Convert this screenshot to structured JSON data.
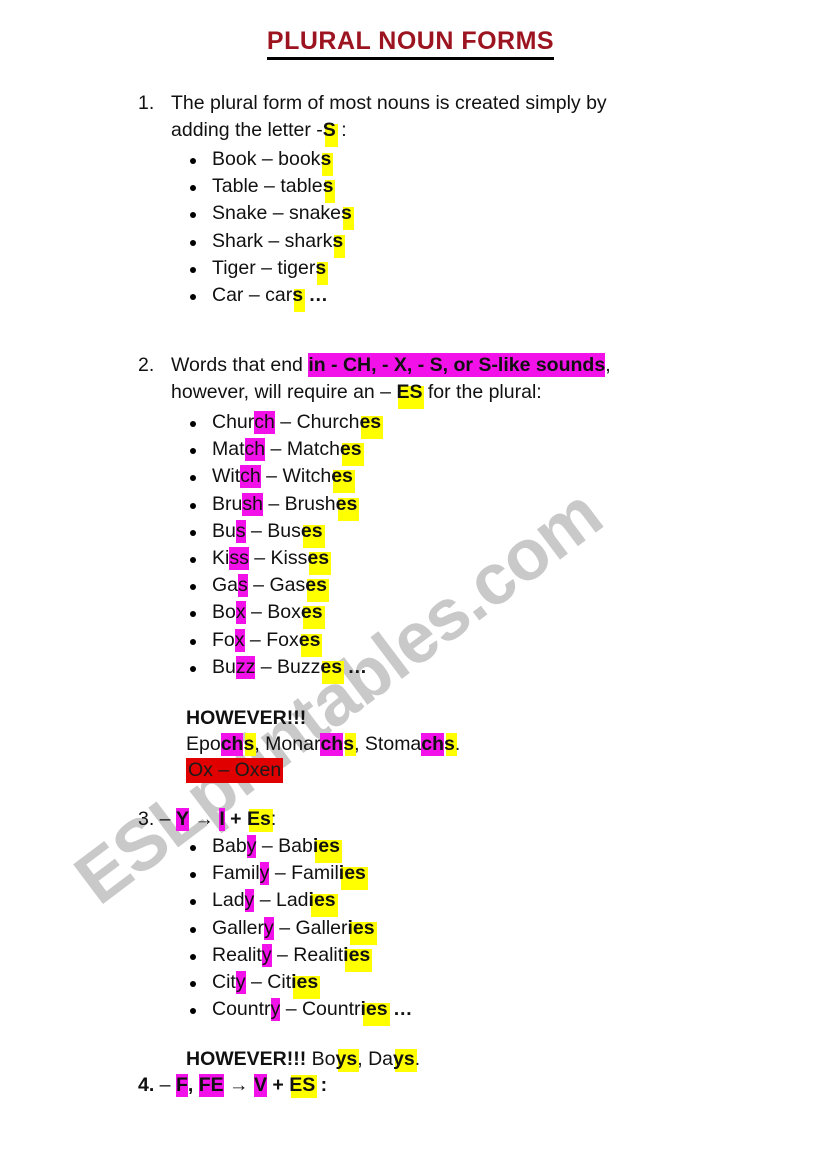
{
  "document": {
    "title": "PLURAL NOUN FORMS",
    "watermark": "ESLprintables.com",
    "colors": {
      "title": "#9c1420",
      "highlight_yellow": "#ffff00",
      "highlight_magenta": "#f211e8",
      "highlight_red": "#e00000",
      "watermark": "#c9c9c9",
      "text": "#111111"
    }
  },
  "sections": {
    "rule1": {
      "number": "1.",
      "line1": "The plural form of most nouns is created simply by",
      "line2_pre": "adding the letter -",
      "line2_highlight": "S",
      "line2_post": " :",
      "examples": [
        {
          "singular": "Book",
          "dash": " – ",
          "plural_stem": "book",
          "plural_suffix": "s",
          "trailing": ""
        },
        {
          "singular": "Table",
          "dash": " – ",
          "plural_stem": "table",
          "plural_suffix": "s",
          "trailing": ""
        },
        {
          "singular": "Snake",
          "dash": " – ",
          "plural_stem": "snake",
          "plural_suffix": "s",
          "trailing": ""
        },
        {
          "singular": "Shark",
          "dash": " – ",
          "plural_stem": "shark",
          "plural_suffix": "s",
          "trailing": ""
        },
        {
          "singular": "Tiger",
          "dash": " – ",
          "plural_stem": "tiger",
          "plural_suffix": "s",
          "trailing": ""
        },
        {
          "singular": "Car",
          "dash": " – ",
          "plural_stem": "car",
          "plural_suffix": "s",
          "trailing": " …"
        }
      ]
    },
    "rule2": {
      "number": "2.",
      "line1_pre": " Words that end ",
      "line1_highlight": "in  - CH, - X, - S, or S-like sounds",
      "line1_post": ",",
      "line2_pre": "however, will require an – ",
      "line2_highlight": "ES",
      "line2_post": " for the plural:",
      "examples": [
        {
          "sing_pre": "Chur",
          "sing_mark": "ch",
          "sing_post": "",
          "dash": " – ",
          "plu_pre": "Church",
          "plu_mark": "es",
          "plu_post": "",
          "trailing": ""
        },
        {
          "sing_pre": "Mat",
          "sing_mark": "ch",
          "sing_post": "",
          "dash": " – ",
          "plu_pre": "Match",
          "plu_mark": "es",
          "plu_post": "",
          "trailing": ""
        },
        {
          "sing_pre": "Wit",
          "sing_mark": "ch",
          "sing_post": "",
          "dash": " – ",
          "plu_pre": "Witch",
          "plu_mark": "es",
          "plu_post": "",
          "trailing": ""
        },
        {
          "sing_pre": "Bru",
          "sing_mark": "sh",
          "sing_post": "",
          "dash": " – ",
          "plu_pre": "Brush",
          "plu_mark": "es",
          "plu_post": "",
          "trailing": ""
        },
        {
          "sing_pre": "Bu",
          "sing_mark": "s",
          "sing_post": "",
          "dash": " – ",
          "plu_pre": "Bus",
          "plu_mark": "es",
          "plu_post": "",
          "trailing": ""
        },
        {
          "sing_pre": "Ki",
          "sing_mark": "ss",
          "sing_post": "",
          "dash": " – ",
          "plu_pre": "Kiss",
          "plu_mark": "es",
          "plu_post": "",
          "trailing": ""
        },
        {
          "sing_pre": "Ga",
          "sing_mark": "s",
          "sing_post": "",
          "dash": " – ",
          "plu_pre": "Gas",
          "plu_mark": "es",
          "plu_post": "",
          "trailing": ""
        },
        {
          "sing_pre": "Bo",
          "sing_mark": "x",
          "sing_post": "",
          "dash": " – ",
          "plu_pre": "Box",
          "plu_mark": "es",
          "plu_post": "",
          "trailing": ""
        },
        {
          "sing_pre": "Fo",
          "sing_mark": "x",
          "sing_post": "",
          "dash": " – ",
          "plu_pre": "Fox",
          "plu_mark": "es",
          "plu_post": "",
          "trailing": ""
        },
        {
          "sing_pre": "Bu",
          "sing_mark": "zz",
          "sing_post": "",
          "dash": " – ",
          "plu_pre": "Buzz",
          "plu_mark": "es",
          "plu_post": "",
          "trailing": " …"
        }
      ],
      "however_heading": "HOWEVER!!!",
      "exceptions": [
        {
          "pre": "Epo",
          "mark_m": "ch",
          "mark_y": "s",
          "post": ", "
        },
        {
          "pre": "Monar",
          "mark_m": "ch",
          "mark_y": "s",
          "post": ", "
        },
        {
          "pre": "Stoma",
          "mark_m": "ch",
          "mark_y": "s",
          "post": "."
        }
      ],
      "special": "Ox – Oxen"
    },
    "rule3": {
      "number": "3.",
      "formula_pre": " – ",
      "formula_y": "Y",
      "formula_arrow": " → ",
      "formula_i": "I",
      "formula_plus": " + ",
      "formula_es": "Es",
      "formula_post": ":",
      "examples": [
        {
          "sing_pre": "Bab",
          "sing_mark": "y",
          "dash": " – ",
          "plu_pre": "Bab",
          "plu_mark": "ies",
          "trailing": ""
        },
        {
          "sing_pre": "Famil",
          "sing_mark": "y",
          "dash": " – ",
          "plu_pre": "Famil",
          "plu_mark": "ies",
          "trailing": ""
        },
        {
          "sing_pre": "Lad",
          "sing_mark": "y",
          "dash": " – ",
          "plu_pre": "Lad",
          "plu_mark": "ies",
          "trailing": ""
        },
        {
          "sing_pre": "Galler",
          "sing_mark": "y",
          "dash": " – ",
          "plu_pre": "Galler",
          "plu_mark": "ies",
          "trailing": ""
        },
        {
          "sing_pre": "Realit",
          "sing_mark": "y",
          "dash": " – ",
          "plu_pre": "Realit",
          "plu_mark": "ies",
          "trailing": ""
        },
        {
          "sing_pre": "Cit",
          "sing_mark": "y",
          "dash": " – ",
          "plu_pre": "Cit",
          "plu_mark": "ies",
          "trailing": ""
        },
        {
          "sing_pre": "Countr",
          "sing_mark": "y",
          "dash": " – ",
          "plu_pre": "Countr",
          "plu_mark": "ies",
          "trailing": " …"
        }
      ],
      "however_heading": "HOWEVER!!!",
      "however_items": [
        {
          "pre": "Bo",
          "mark": "ys",
          "post": ", "
        },
        {
          "pre": "Da",
          "mark": "ys",
          "post": "."
        }
      ]
    },
    "rule4": {
      "number": "4.",
      "formula_pre": "  – ",
      "formula_f": "F",
      "formula_comma": ", ",
      "formula_fe": "FE",
      "formula_arrow": " → ",
      "formula_v": "V",
      "formula_plus": " + ",
      "formula_es": "ES",
      "formula_post": " :"
    }
  }
}
